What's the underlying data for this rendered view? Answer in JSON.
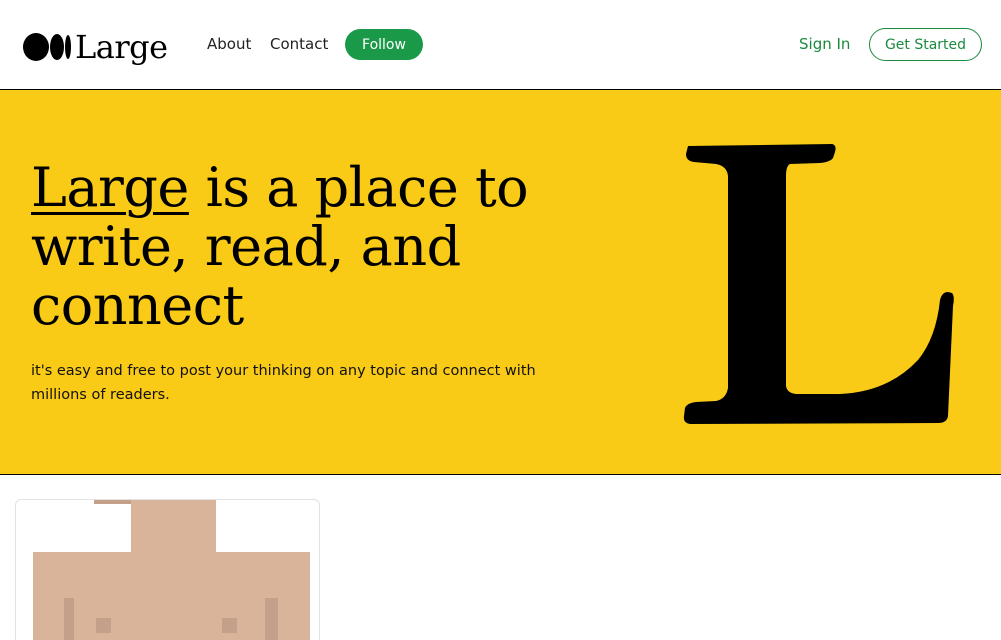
{
  "header": {
    "brand": "Large",
    "nav": {
      "about": "About",
      "contact": "Contact",
      "follow": "Follow"
    },
    "signin": "Sign In",
    "get_started": "Get Started"
  },
  "hero": {
    "title_brand": "Large",
    "title_rest": " is a place to write, read, and connect",
    "subtitle": "it's easy and free to post your thinking on any topic and connect with millions of readers.",
    "graphic_icon": "large-L-letter-icon"
  },
  "colors": {
    "hero_bg": "#f9cb17",
    "accent_green": "#1a9a48",
    "card_art": "#d9b49b"
  },
  "cards": [
    {
      "image_icon": "pixel-art-figure-icon"
    }
  ]
}
